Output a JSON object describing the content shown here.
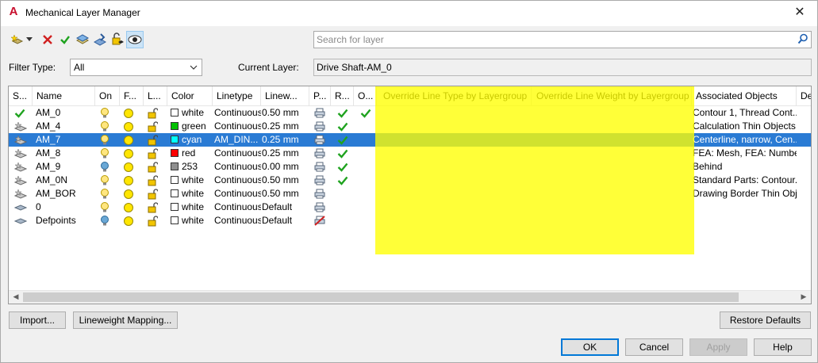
{
  "window": {
    "title": "Mechanical Layer Manager"
  },
  "search": {
    "placeholder": "Search for layer"
  },
  "filter": {
    "label": "Filter Type:",
    "value": "All"
  },
  "current_layer": {
    "label": "Current Layer:",
    "value": "Drive Shaft-AM_0"
  },
  "columns": [
    "S...",
    "Name",
    "On",
    "F...",
    "L...",
    "Color",
    "Linetype",
    "Linew...",
    "P...",
    "R...",
    "O...",
    "Override Line Type by Layergroup",
    "Override Line Weight by Layergroup",
    "Associated Objects",
    "De"
  ],
  "rows": [
    {
      "name": "AM_0",
      "status": "current",
      "on": true,
      "color_name": "white",
      "color": "#ffffff",
      "linetype": "Continuous",
      "lineweight": "0.50 mm",
      "r": true,
      "o": true,
      "assoc": "Contour 1, Thread Cont..."
    },
    {
      "name": "AM_4",
      "status": "layer",
      "on": true,
      "color_name": "green",
      "color": "#00c000",
      "linetype": "Continuous",
      "lineweight": "0.25 mm",
      "r": true,
      "o": false,
      "assoc": "Calculation Thin Objects..."
    },
    {
      "name": "AM_7",
      "status": "layer",
      "on": true,
      "color_name": "cyan",
      "color": "#00ffff",
      "linetype": "AM_DIN...",
      "lineweight": "0.25 mm",
      "r": true,
      "o": false,
      "assoc": "Centerline, narrow, Cen...",
      "selected": true
    },
    {
      "name": "AM_8",
      "status": "layer",
      "on": true,
      "color_name": "red",
      "color": "#ff0000",
      "linetype": "Continuous",
      "lineweight": "0.25 mm",
      "r": true,
      "o": false,
      "assoc": "FEA: Mesh, FEA: Numbe..."
    },
    {
      "name": "AM_9",
      "status": "layer",
      "on": false,
      "color_name": "253",
      "color": "#8f8f8f",
      "linetype": "Continuous",
      "lineweight": "0.00 mm",
      "r": true,
      "o": false,
      "assoc": "Behind"
    },
    {
      "name": "AM_0N",
      "status": "layer",
      "on": true,
      "color_name": "white",
      "color": "#ffffff",
      "linetype": "Continuous",
      "lineweight": "0.50 mm",
      "r": true,
      "o": false,
      "assoc": "Standard Parts: Contour..."
    },
    {
      "name": "AM_BOR",
      "status": "layer",
      "on": true,
      "color_name": "white",
      "color": "#ffffff",
      "linetype": "Continuous",
      "lineweight": "0.50 mm",
      "r": false,
      "o": false,
      "assoc": "Drawing Border Thin Obj..."
    },
    {
      "name": "0",
      "status": "plain",
      "on": true,
      "color_name": "white",
      "color": "#ffffff",
      "linetype": "Continuous",
      "lineweight": "Default",
      "r": false,
      "o": false,
      "assoc": ""
    },
    {
      "name": "Defpoints",
      "status": "plain",
      "on": false,
      "color_name": "white",
      "color": "#ffffff",
      "linetype": "Continuous",
      "lineweight": "Default",
      "r": false,
      "o": false,
      "noplot": true,
      "assoc": ""
    }
  ],
  "buttons": {
    "import": "Import...",
    "lineweight_mapping": "Lineweight Mapping...",
    "restore_defaults": "Restore Defaults",
    "ok": "OK",
    "cancel": "Cancel",
    "apply": "Apply",
    "help": "Help"
  },
  "colors": {
    "selection": "#2a7bd4",
    "highlight": "#ffff00",
    "check": "#1fa31f"
  }
}
